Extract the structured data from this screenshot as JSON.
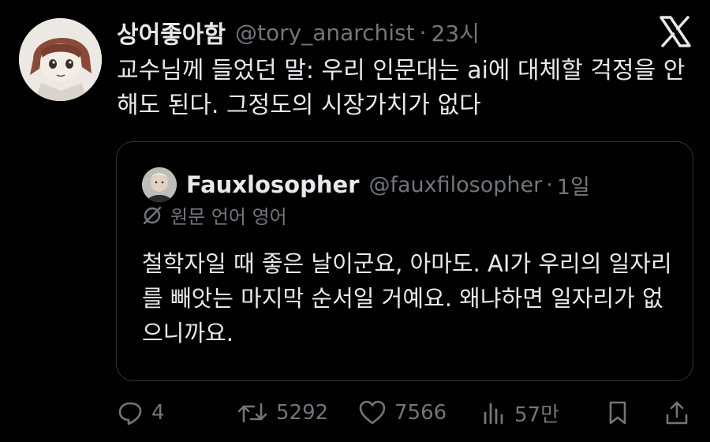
{
  "tweet": {
    "display_name": "상어좋아함",
    "handle": "@tory_anarchist",
    "separator": "·",
    "time": "23시",
    "text": "교수님께 들었던 말: 우리 인문대는 ai에 대체할 걱정을 안해도 된다. 그정도의 시장가치가 없다"
  },
  "quote": {
    "display_name": "Fauxlosopher",
    "handle": "@fauxfilosopher",
    "separator": "·",
    "time": "1일",
    "translate_label": "원문 언어 영어",
    "text": "철학자일 때 좋은 날이군요, 아마도. AI가 우리의 일자리를 빼앗는 마지막 순서일 거예요. 왜냐하면 일자리가 없으니까요."
  },
  "actions": {
    "replies": "4",
    "retweets": "5292",
    "likes": "7566",
    "views": "57만"
  },
  "icons": {
    "logo": "x-logo-icon",
    "reply": "reply-icon",
    "retweet": "retweet-icon",
    "like": "heart-icon",
    "views": "views-icon",
    "bookmark": "bookmark-icon",
    "share": "share-icon"
  },
  "colors": {
    "background": "#000000",
    "text": "#e7e9ea",
    "muted": "#71767b",
    "border": "#2f3336"
  }
}
